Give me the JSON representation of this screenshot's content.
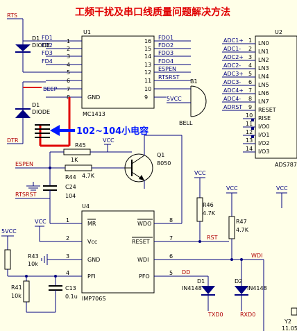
{
  "title": "工频干扰及串口线质量问题解决方法",
  "annotation": "102~104小电容",
  "u1": {
    "ref": "U1",
    "part": "MC1413",
    "left_pins": [
      {
        "num": "1",
        "name": "FD1"
      },
      {
        "num": "2",
        "name": "FD2"
      },
      {
        "num": "3",
        "name": "FD3"
      },
      {
        "num": "4",
        "name": "FD4"
      },
      {
        "num": "5",
        "name": "RTS"
      },
      {
        "num": "6",
        "name": "DTR"
      },
      {
        "num": "7",
        "name": "BEEP"
      },
      {
        "num": "8",
        "name": "GND"
      }
    ],
    "right_pins": [
      {
        "num": "16",
        "name": "FDO1"
      },
      {
        "num": "15",
        "name": "FDO2"
      },
      {
        "num": "14",
        "name": "FDO3"
      },
      {
        "num": "13",
        "name": "FDO4"
      },
      {
        "num": "12",
        "name": "ESPEN"
      },
      {
        "num": "11",
        "name": "RTSRST"
      },
      {
        "num": "10",
        "name": ""
      },
      {
        "num": "9",
        "name": ""
      }
    ]
  },
  "u2": {
    "ref": "U2",
    "part": "ADS787",
    "nets": [
      "ADC1+",
      "ADC1-",
      "ADC2+",
      "ADC2-",
      "ADC3+",
      "ADC3-",
      "ADC4+",
      "ADC4-",
      "ADRST"
    ],
    "pin_numbers": [
      "1",
      "2",
      "3",
      "4",
      "5",
      "6",
      "7",
      "8",
      "9",
      "10",
      "11",
      "12",
      "13",
      "14"
    ],
    "pin_names": [
      "LN0",
      "LN1",
      "LN2",
      "LN3",
      "LN4",
      "LN5",
      "LN6",
      "LN7",
      "RESET",
      "RISE",
      "I/O0",
      "I/O1",
      "I/O2",
      "I/O3"
    ]
  },
  "u4": {
    "ref": "U4",
    "part": "IMP706S",
    "left_pins": [
      {
        "num": "1",
        "name": "MR"
      },
      {
        "num": "2",
        "name": "Vcc"
      },
      {
        "num": "3",
        "name": "GND"
      },
      {
        "num": "4",
        "name": "PFI"
      }
    ],
    "right_pins": [
      {
        "num": "8",
        "name": "WDO"
      },
      {
        "num": "7",
        "name": "RESET"
      },
      {
        "num": "6",
        "name": "WDI"
      },
      {
        "num": "5",
        "name": "PFO"
      }
    ]
  },
  "nets": {
    "rts": "RTS",
    "dtr": "DTR",
    "espen": "ESPEN",
    "rtsrst": "RTSRST",
    "rst": "RST",
    "wdi": "WDI",
    "dd": "DD",
    "txd0": "TXD0",
    "rxd0": "RXD0",
    "vcc": "VCC",
    "five_vcc": "5VCC"
  },
  "components": {
    "d1_ref": "D1",
    "d1_part": "DIODE",
    "d2_ref": "D1",
    "d2_part": "DIODE",
    "b1_ref": "B1",
    "b1_part": "BELL",
    "r45_ref": "R45",
    "r45_val": "1K",
    "r44_ref": "R44",
    "r44_val": "4.7K",
    "c24_ref": "C24",
    "c24_val": "104",
    "q1_ref": "Q1",
    "q1_part": "8050",
    "r46_ref": "R46",
    "r46_val": "4.7K",
    "r47_ref": "R47",
    "r47_val": "4.7K",
    "r43_ref": "R43",
    "r43_val": "10k",
    "r41_ref": "R41",
    "r41_val": "10k",
    "c13_ref": "C13",
    "c13_val": "0.1u",
    "dd1_ref": "D1",
    "dd1_part": "IN4148",
    "dd2_ref": "D2",
    "dd2_part": "IN4148",
    "y2_ref": "Y2",
    "y2_val": "11.05"
  },
  "colors": {
    "background": "#ffffe8",
    "wire": "#000080",
    "body": "#000000",
    "title": "#e00000",
    "highlight": "#e00000",
    "annotation": "#0018ff"
  }
}
